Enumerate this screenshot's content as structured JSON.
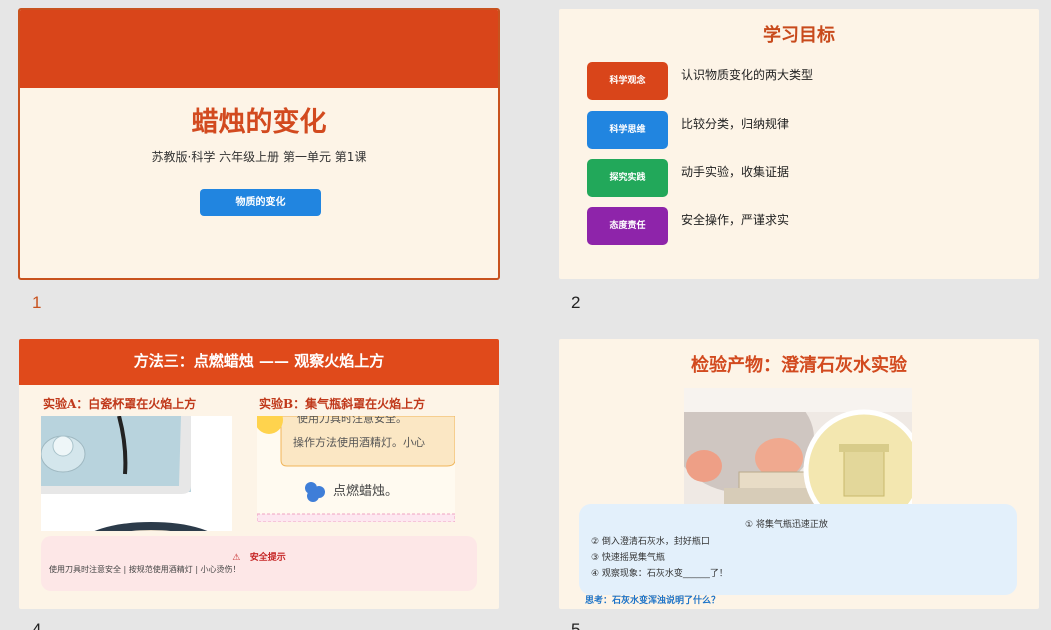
{
  "slides": [
    {
      "number": "1",
      "title": "蜡烛的变化",
      "subtitle": "苏教版·科学 六年级上册  第一单元 第1课",
      "pill": "物质的变化",
      "colors": {
        "band": "#d9451a",
        "pill": "#2185e0"
      }
    },
    {
      "number": "2",
      "title": "学习目标",
      "goals": [
        {
          "tag": "科学观念",
          "text": "认识物质变化的两大类型",
          "color": "#d9451a"
        },
        {
          "tag": "科学思维",
          "text": "比较分类，归纳规律",
          "color": "#2185e0"
        },
        {
          "tag": "探究实践",
          "text": "动手实验，收集证据",
          "color": "#22a85a"
        },
        {
          "tag": "态度责任",
          "text": "安全操作，严谨求实",
          "color": "#8e24aa"
        }
      ]
    },
    {
      "number": "4",
      "title": "方法三：点燃蜡烛 —— 观察火焰上方",
      "exp_a": "实验A：白瓷杯罩在火焰上方",
      "exp_b": "实验B：集气瓶斜罩在火焰上方",
      "photo_b_lines": [
        "使用刀具时注意安全。",
        "操作方法使用酒精灯。小心",
        "点燃蜡烛。"
      ],
      "safety_title": "安全提示",
      "safety_text": "使用刀具时注意安全 | 按规范使用酒精灯 | 小心烫伤！"
    },
    {
      "number": "5",
      "title": "检验产物：澄清石灰水实验",
      "steps": [
        "① 将集气瓶迅速正放",
        "② 倒入澄清石灰水，封好瓶口",
        "③ 快速摇晃集气瓶",
        "④ 观察现象：石灰水变______了！"
      ],
      "think": "思考：石灰水变浑浊说明了什么？"
    }
  ]
}
